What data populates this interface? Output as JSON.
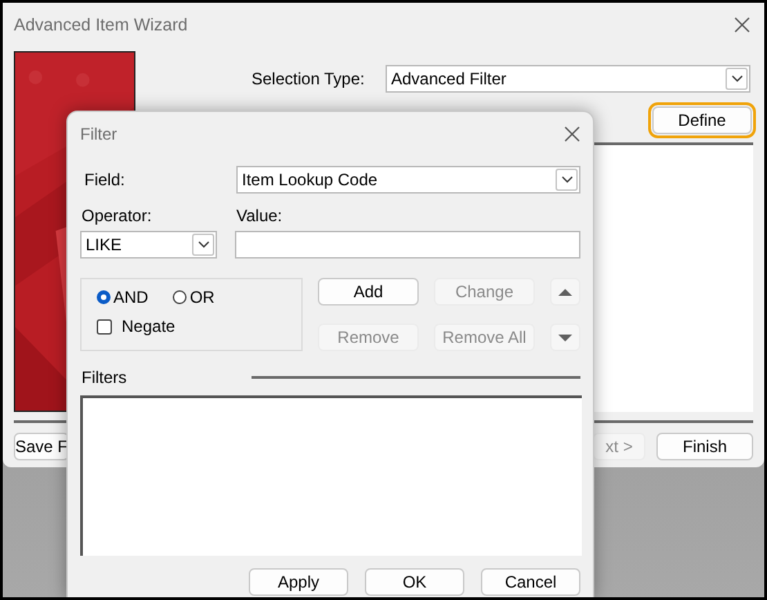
{
  "main_window": {
    "title": "Advanced Item Wizard",
    "selection_type": {
      "label": "Selection Type:",
      "value": "Advanced Filter"
    },
    "define_button": {
      "label": "Define",
      "focused": true
    },
    "buttons": [
      {
        "label": "Save F",
        "disabled": false
      },
      {
        "label": "xt >",
        "disabled": true
      },
      {
        "label": "Finish",
        "disabled": false
      }
    ]
  },
  "filter_dialog": {
    "title": "Filter",
    "field": {
      "label": "Field:",
      "value": "Item Lookup Code"
    },
    "operator": {
      "label": "Operator:",
      "value": "LIKE"
    },
    "value": {
      "label": "Value:"
    },
    "logic": [
      {
        "label": "AND",
        "selected": true
      },
      {
        "label": "OR",
        "selected": false
      }
    ],
    "negate": {
      "label": "Negate",
      "checked": false
    },
    "action_buttons": [
      {
        "label": "Add",
        "disabled": false
      },
      {
        "label": "Change",
        "disabled": true
      },
      {
        "label": "Remove",
        "disabled": true
      },
      {
        "label": "Remove All",
        "disabled": true
      }
    ],
    "move_buttons": [
      {
        "kind": "up",
        "disabled": true
      },
      {
        "kind": "down",
        "disabled": true
      }
    ],
    "filters_label": "Filters",
    "dialog_buttons": [
      {
        "label": "Apply",
        "disabled": false
      },
      {
        "label": "OK",
        "disabled": false
      },
      {
        "label": "Cancel",
        "disabled": false
      }
    ]
  }
}
